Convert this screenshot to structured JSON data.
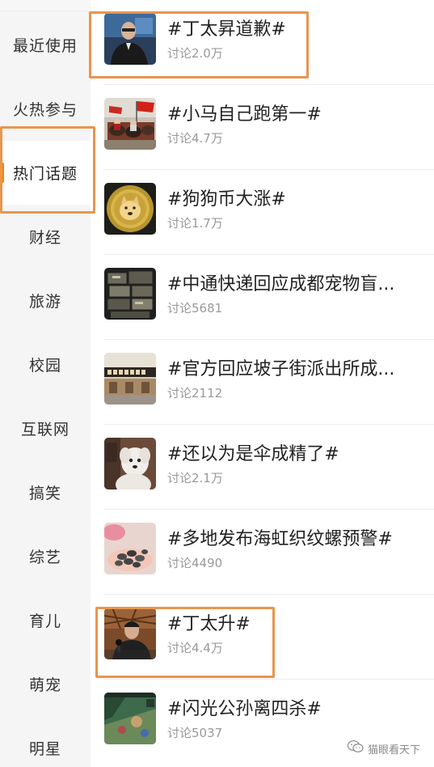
{
  "sidebar": {
    "categories": [
      {
        "label": "最近使用"
      },
      {
        "label": "火热参与"
      },
      {
        "label": "热门话题",
        "active": true
      },
      {
        "label": "财经"
      },
      {
        "label": "旅游"
      },
      {
        "label": "校园"
      },
      {
        "label": "互联网"
      },
      {
        "label": "搞笑"
      },
      {
        "label": "综艺"
      },
      {
        "label": "育儿"
      },
      {
        "label": "萌宠"
      },
      {
        "label": "明星"
      }
    ]
  },
  "topics": [
    {
      "title": "#丁太昇道歉#",
      "meta": "讨论2.0万",
      "thumb": "man-at-event-thumbnail"
    },
    {
      "title": "#小马自己跑第一#",
      "meta": "讨论4.7万",
      "thumb": "horses-and-flags-thumbnail"
    },
    {
      "title": "#狗狗币大涨#",
      "meta": "讨论1.7万",
      "thumb": "dogecoin-thumbnail"
    },
    {
      "title": "#中通快递回应成都宠物盲...",
      "meta": "讨论5681",
      "thumb": "stacked-boxes-thumbnail"
    },
    {
      "title": "#官方回应坡子街派出所成...",
      "meta": "讨论2112",
      "thumb": "street-sign-thumbnail"
    },
    {
      "title": "#还以为是伞成精了#",
      "meta": "讨论2.1万",
      "thumb": "white-dog-meme-thumbnail"
    },
    {
      "title": "#多地发布海虹织纹螺预警#",
      "meta": "讨论4490",
      "thumb": "sea-snails-thumbnail"
    },
    {
      "title": "#丁太升#",
      "meta": "讨论4.4万",
      "thumb": "man-with-microphone-thumbnail"
    },
    {
      "title": "#闪光公孙离四杀#",
      "meta": "讨论5037",
      "thumb": "game-scene-thumbnail"
    }
  ],
  "watermark": {
    "text": "猫眼看天下",
    "icon": "wechat-icon"
  },
  "colors": {
    "accent": "#ff8200",
    "highlight_box": "#e8954e",
    "meta_text": "#999999",
    "sidebar_bg": "#f5f5f5"
  }
}
